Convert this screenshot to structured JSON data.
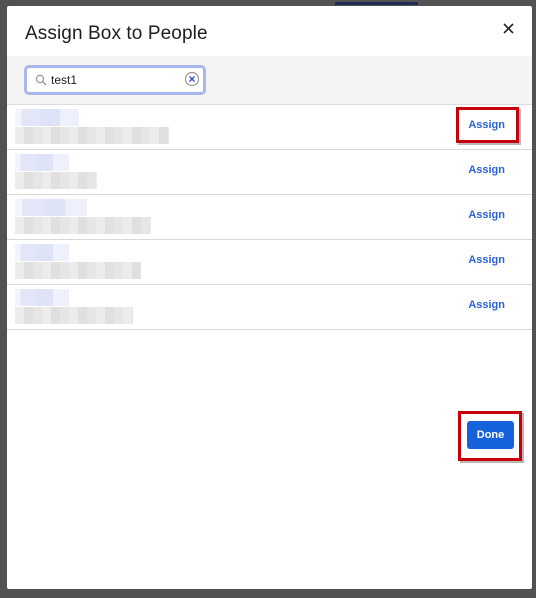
{
  "modal": {
    "title": "Assign Box to People",
    "close_icon": "close-icon"
  },
  "search": {
    "value": "test1",
    "icon": "search-icon",
    "clear_icon": "clear-circle-x-icon"
  },
  "people": [
    {
      "name": "[blurred]",
      "detail": "[blurred]",
      "action_label": "Assign",
      "highlighted": true
    },
    {
      "name": "[blurred]",
      "detail": "[blurred]",
      "action_label": "Assign",
      "highlighted": false
    },
    {
      "name": "[blurred]",
      "detail": "[blurred]",
      "action_label": "Assign",
      "highlighted": false
    },
    {
      "name": "[blurred]",
      "detail": "[blurred]",
      "action_label": "Assign",
      "highlighted": false
    },
    {
      "name": "[blurred]",
      "detail": "[blurred]",
      "action_label": "Assign",
      "highlighted": false
    }
  ],
  "footer": {
    "done_label": "Done",
    "done_highlighted": true
  },
  "colors": {
    "accent": "#1662dd",
    "link": "#2a62d8",
    "highlight": "#c8000c",
    "overlay": "#525254"
  }
}
